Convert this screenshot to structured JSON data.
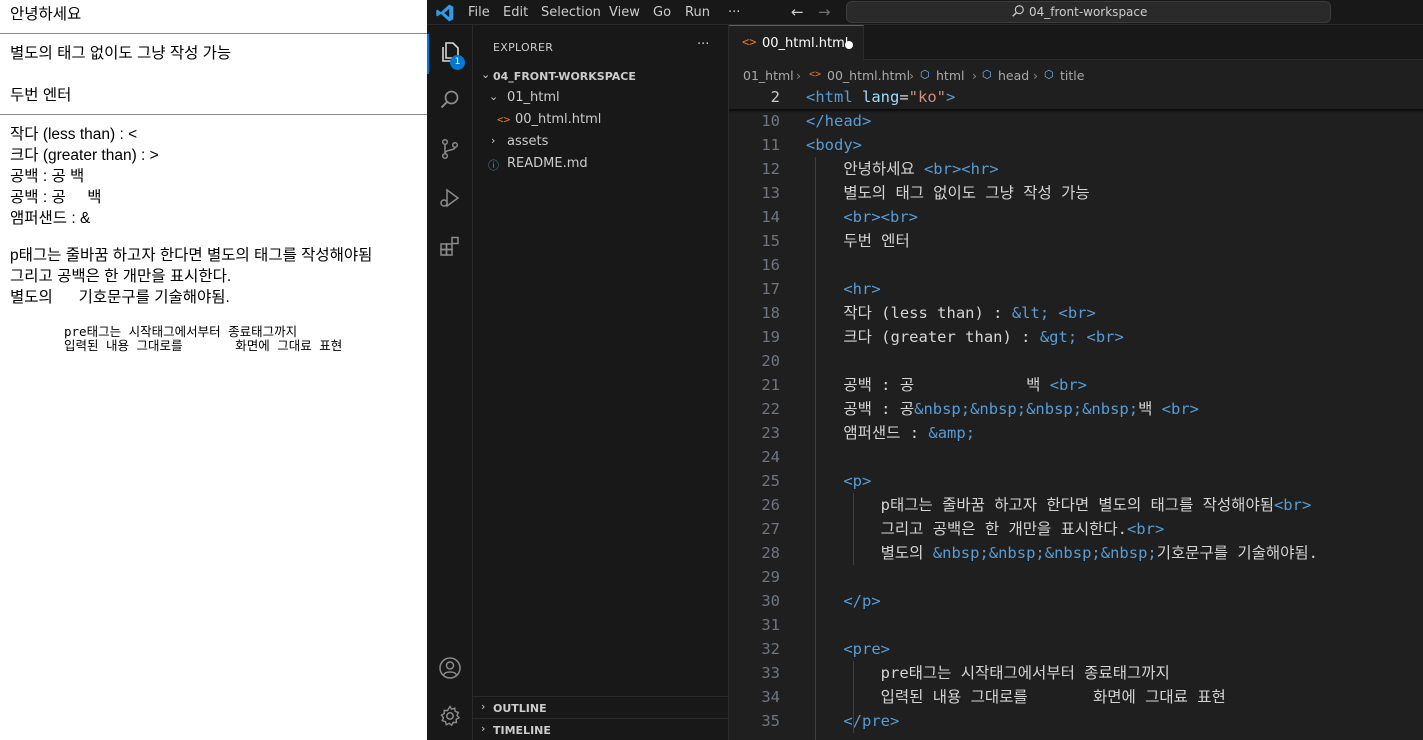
{
  "preview": {
    "line1": "안녕하세요",
    "line2": "별도의 태그 없이도 그냥 작성 가능",
    "line3": "두번 엔터",
    "line4": "작다 (less than) : <",
    "line5": "크다 (greater than) : >",
    "line6": "공백 : 공 백",
    "line7": "공백 : 공     백",
    "line8": "앰퍼샌드 : &",
    "para1": "p태그는 줄바꿈 하고자 한다면 별도의 태그를 작성해야됨",
    "para2": "그리고 공백은 한 개만을 표시한다.",
    "para3": "별도의      기호문구를 기술해야됨.",
    "pre1": "pre태그는 시작태그에서부터 종료태그까지",
    "pre2": "입력된 내용 그대로를       화면에 그대료 표현"
  },
  "titlebar": {
    "menu": [
      "File",
      "Edit",
      "Selection",
      "View",
      "Go",
      "Run",
      "···"
    ],
    "search_text": "04_front-workspace"
  },
  "activitybar": {
    "explorer_badge": "1"
  },
  "sidebar": {
    "title": "EXPLORER",
    "more": "···",
    "root": "04_FRONT-WORKSPACE",
    "folder_01": "01_html",
    "file_html": "00_html.html",
    "folder_assets": "assets",
    "file_readme": "README.md",
    "outline": "OUTLINE",
    "timeline": "TIMELINE"
  },
  "editor": {
    "tab_label": "00_html.html",
    "breadcrumb": [
      "01_html",
      "00_html.html",
      "html",
      "head",
      "title"
    ],
    "lines": [
      {
        "n": "2",
        "segs": [
          [
            "tg",
            "<html "
          ],
          [
            "at",
            "lang"
          ],
          [
            "tx",
            "="
          ],
          [
            "st",
            "\"ko\""
          ],
          [
            "tg",
            ">"
          ]
        ]
      },
      {
        "n": "10",
        "segs": [
          [
            "tg",
            "</head>"
          ]
        ]
      },
      {
        "n": "11",
        "segs": [
          [
            "tg",
            "<body>"
          ]
        ]
      },
      {
        "n": "12",
        "segs": [
          [
            "tx",
            "    안녕하세요 "
          ],
          [
            "tg",
            "<br><hr>"
          ]
        ]
      },
      {
        "n": "13",
        "segs": [
          [
            "tx",
            "    별도의 태그 없이도 그냥 작성 가능"
          ]
        ]
      },
      {
        "n": "14",
        "segs": [
          [
            "tx",
            "    "
          ],
          [
            "tg",
            "<br><br>"
          ]
        ]
      },
      {
        "n": "15",
        "segs": [
          [
            "tx",
            "    두번 엔터"
          ]
        ]
      },
      {
        "n": "16",
        "segs": []
      },
      {
        "n": "17",
        "segs": [
          [
            "tx",
            "    "
          ],
          [
            "tg",
            "<hr>"
          ]
        ]
      },
      {
        "n": "18",
        "segs": [
          [
            "tx",
            "    작다 (less than) : "
          ],
          [
            "en",
            "&lt;"
          ],
          [
            "tx",
            " "
          ],
          [
            "tg",
            "<br>"
          ]
        ]
      },
      {
        "n": "19",
        "segs": [
          [
            "tx",
            "    크다 (greater than) : "
          ],
          [
            "en",
            "&gt;"
          ],
          [
            "tx",
            " "
          ],
          [
            "tg",
            "<br>"
          ]
        ]
      },
      {
        "n": "20",
        "segs": []
      },
      {
        "n": "21",
        "segs": [
          [
            "tx",
            "    공백 : 공            백 "
          ],
          [
            "tg",
            "<br>"
          ]
        ]
      },
      {
        "n": "22",
        "segs": [
          [
            "tx",
            "    공백 : 공"
          ],
          [
            "en",
            "&nbsp;&nbsp;&nbsp;&nbsp;"
          ],
          [
            "tx",
            "백 "
          ],
          [
            "tg",
            "<br>"
          ]
        ]
      },
      {
        "n": "23",
        "segs": [
          [
            "tx",
            "    앰퍼샌드 : "
          ],
          [
            "en",
            "&amp;"
          ]
        ]
      },
      {
        "n": "24",
        "segs": []
      },
      {
        "n": "25",
        "segs": [
          [
            "tx",
            "    "
          ],
          [
            "tg",
            "<p>"
          ]
        ]
      },
      {
        "n": "26",
        "segs": [
          [
            "tx",
            "        p태그는 줄바꿈 하고자 한다면 별도의 태그를 작성해야됨"
          ],
          [
            "tg",
            "<br>"
          ]
        ]
      },
      {
        "n": "27",
        "segs": [
          [
            "tx",
            "        그리고 공백은 한 개만을 표시한다."
          ],
          [
            "tg",
            "<br>"
          ]
        ]
      },
      {
        "n": "28",
        "segs": [
          [
            "tx",
            "        별도의 "
          ],
          [
            "en",
            "&nbsp;&nbsp;&nbsp;&nbsp;"
          ],
          [
            "tx",
            "기호문구를 기술해야됨."
          ]
        ]
      },
      {
        "n": "29",
        "segs": []
      },
      {
        "n": "30",
        "segs": [
          [
            "tx",
            "    "
          ],
          [
            "tg",
            "</p>"
          ]
        ]
      },
      {
        "n": "31",
        "segs": []
      },
      {
        "n": "32",
        "segs": [
          [
            "tx",
            "    "
          ],
          [
            "tg",
            "<pre>"
          ]
        ]
      },
      {
        "n": "33",
        "segs": [
          [
            "tx",
            "        pre태그는 시작태그에서부터 종료태그까지"
          ]
        ]
      },
      {
        "n": "34",
        "segs": [
          [
            "tx",
            "        입력된 내용 그대로를       화면에 그대료 표현"
          ]
        ]
      },
      {
        "n": "35",
        "segs": [
          [
            "tx",
            "    "
          ],
          [
            "tg",
            "</pre>"
          ]
        ]
      }
    ]
  },
  "colors": {
    "accent": "#0078d4",
    "tag": "#569cd6",
    "attr": "#9cdcfe",
    "string": "#ce9178",
    "text": "#d4d4d4",
    "html_icon": "#e37933"
  }
}
